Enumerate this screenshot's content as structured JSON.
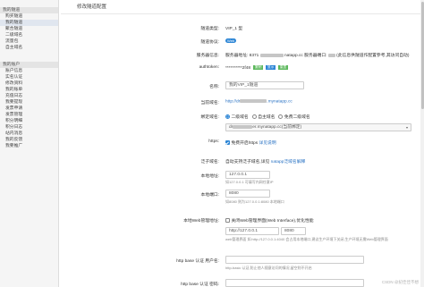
{
  "sidebar": {
    "sections": [
      {
        "title": "我的隧道",
        "items": [
          "购买隧道",
          "我的隧道",
          "聚合隧道",
          "二级域名",
          "流量包",
          "自主域名"
        ]
      },
      {
        "title": "我的账户",
        "items": [
          "账户信息",
          "实名认证",
          "修改资料",
          "我的账单",
          "充值日志",
          "我要提现",
          "发票申请",
          "发票管理",
          "积分明细",
          "积分日志",
          "站内消息",
          "我的反馈",
          "我要推广"
        ]
      }
    ],
    "active_item": "我的隧道"
  },
  "page": {
    "title": "修改隧道配置"
  },
  "form": {
    "tunnel_type": {
      "label": "隧道类型:",
      "value": "VIP_1 型"
    },
    "protocol": {
      "label": "隧道协议:",
      "value": "Web"
    },
    "server": {
      "label": "服务器信息:",
      "value_prefix": "服务器地址: 8371",
      "value_mid": "natapp.cc 服务器端口:",
      "value_suffix": "(此信息供隧道作配置参考,其访问自动)"
    },
    "authtoken": {
      "label": "authtoken:",
      "value": "**********2f48",
      "btn_copy": "复制",
      "btn_show": "显示",
      "btn_reset": "重置"
    },
    "name": {
      "label": "名称:",
      "value": "我的VIP_1隧道"
    },
    "current_domain": {
      "label": "当前域名:",
      "value_prefix": "http://dr",
      "value_suffix": ".mynatapp.cc"
    },
    "bind_domain": {
      "label": "绑定域名:",
      "option_sub": "二级域名",
      "option_own": "自主域名",
      "option_free": "免费二级域名",
      "select_prefix": "dr",
      "select_suffix": "er.mynatapp.cc(当前绑定)"
    },
    "https": {
      "label": "https:",
      "text": "免费开启https",
      "link_text": "详见说明"
    },
    "pan_domain": {
      "label": "泛子域名:",
      "text": "自动支持泛子域名,详见",
      "link_text": "natapp泛域名解释"
    },
    "local_addr": {
      "label": "本地地址:",
      "value": "127.0.0.1",
      "hint": "如127.0.0.1 可填写内网任意IP"
    },
    "local_port": {
      "label": "本地端口:",
      "value": "8080",
      "hint": "如8080 则为127.0.0.1:8080 本地端口"
    },
    "web_ui": {
      "label": "本地Web管理地址:",
      "checkbox_text": "关闭Web管理界面(Web Interface),优化性能",
      "addr": "http://127.0.0.1",
      "port": "8080",
      "hint": "web管理界面 如:http://127.0.0.1:4040 会占用本地端口,建议生产环境下关闭,生产环境无需Web管理界面"
    },
    "basic_user": {
      "label": "http base 认证 用户名:",
      "hint": "http-basic 认证,防止他人随意访问的情况,留空则不开启"
    },
    "basic_pass": {
      "label": "http base 认证 密码:"
    }
  },
  "watermark": "CSDN @纪佳佳不想"
}
